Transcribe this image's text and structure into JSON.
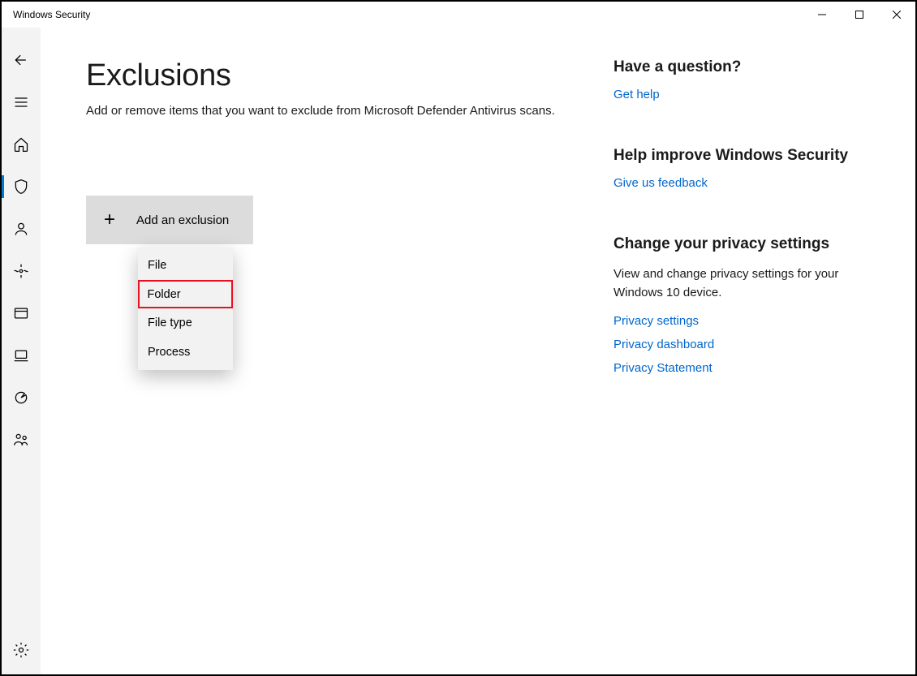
{
  "window": {
    "title": "Windows Security"
  },
  "page": {
    "title": "Exclusions",
    "subtitle": "Add or remove items that you want to exclude from Microsoft Defender Antivirus scans."
  },
  "addButton": {
    "label": "Add an exclusion"
  },
  "dropdown": {
    "items": [
      {
        "label": "File",
        "highlighted": false
      },
      {
        "label": "Folder",
        "highlighted": true
      },
      {
        "label": "File type",
        "highlighted": false
      },
      {
        "label": "Process",
        "highlighted": false
      }
    ]
  },
  "rightPanel": {
    "question": {
      "heading": "Have a question?",
      "link": "Get help"
    },
    "improve": {
      "heading": "Help improve Windows Security",
      "link": "Give us feedback"
    },
    "privacy": {
      "heading": "Change your privacy settings",
      "body": "View and change privacy settings for your Windows 10 device.",
      "links": [
        "Privacy settings",
        "Privacy dashboard",
        "Privacy Statement"
      ]
    }
  }
}
